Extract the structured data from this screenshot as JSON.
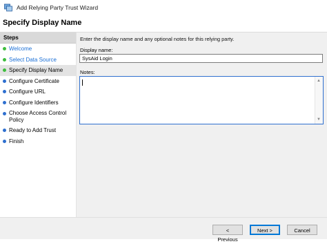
{
  "window": {
    "title": "Add Relying Party Trust Wizard",
    "icon": "wizard-app-icon"
  },
  "header": {
    "title": "Specify Display Name"
  },
  "steps": {
    "title": "Steps",
    "items": [
      {
        "label": "Welcome",
        "state": "completed",
        "color": "#3ebd3e"
      },
      {
        "label": "Select Data Source",
        "state": "completed",
        "color": "#3ebd3e"
      },
      {
        "label": "Specify Display Name",
        "state": "current",
        "color": "#3ebd3e"
      },
      {
        "label": "Configure Certificate",
        "state": "pending",
        "color": "#2e6fcf"
      },
      {
        "label": "Configure URL",
        "state": "pending",
        "color": "#2e6fcf"
      },
      {
        "label": "Configure Identifiers",
        "state": "pending",
        "color": "#2e6fcf"
      },
      {
        "label": "Choose Access Control Policy",
        "state": "pending",
        "color": "#2e6fcf"
      },
      {
        "label": "Ready to Add Trust",
        "state": "pending",
        "color": "#2e6fcf"
      },
      {
        "label": "Finish",
        "state": "pending",
        "color": "#2e6fcf"
      }
    ]
  },
  "main": {
    "intro": "Enter the display name and any optional notes for this relying party.",
    "display_name_label": "Display name:",
    "display_name_value": "SysAid Login",
    "notes_label": "Notes:",
    "notes_value": ""
  },
  "footer": {
    "previous_label": "< Previous",
    "next_label": "Next >",
    "cancel_label": "Cancel"
  },
  "colors": {
    "accent": "#0078d7",
    "completed": "#3ebd3e",
    "pending": "#2e6fcf",
    "link": "#1a6fd6"
  }
}
